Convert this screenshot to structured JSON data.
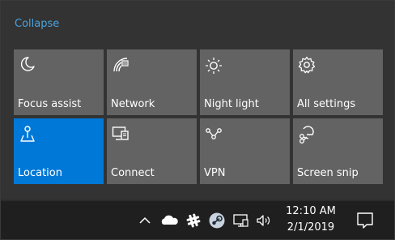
{
  "header": {
    "collapse_label": "Collapse"
  },
  "tiles": [
    {
      "label": "Focus assist",
      "icon": "moon-icon",
      "active": false
    },
    {
      "label": "Network",
      "icon": "network-icon",
      "active": false
    },
    {
      "label": "Night light",
      "icon": "brightness-icon",
      "active": false
    },
    {
      "label": "All settings",
      "icon": "gear-icon",
      "active": false
    },
    {
      "label": "Location",
      "icon": "location-icon",
      "active": true
    },
    {
      "label": "Connect",
      "icon": "connect-icon",
      "active": false
    },
    {
      "label": "VPN",
      "icon": "vpn-icon",
      "active": false
    },
    {
      "label": "Screen snip",
      "icon": "screen-snip-icon",
      "active": false
    }
  ],
  "taskbar": {
    "tray_icons": [
      "chevron-up-icon",
      "onedrive-icon",
      "slack-icon",
      "steam-icon",
      "network-wired-icon",
      "volume-icon"
    ],
    "time": "12:10 AM",
    "date": "2/1/2019",
    "notification_icon": "notification-icon"
  },
  "colors": {
    "accent": "#0078d7",
    "tile": "#636363",
    "panel": "#333333",
    "taskbar": "#1f1f1f",
    "link": "#4aa3df"
  }
}
